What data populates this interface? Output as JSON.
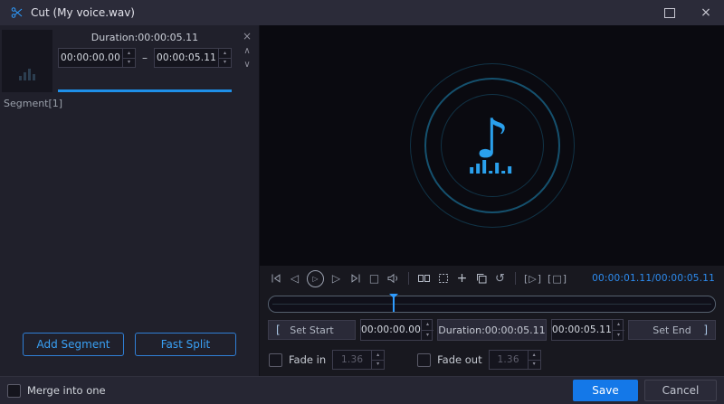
{
  "titlebar": {
    "title": "Cut (My voice.wav)"
  },
  "left_panel": {
    "duration_label": "Duration:00:00:05.11",
    "start_time": "00:00:00.00",
    "range_separator": "–",
    "end_time": "00:00:05.11",
    "segment_label": "Segment[1]",
    "add_segment_button": "Add Segment",
    "fast_split_button": "Fast Split"
  },
  "transport": {
    "time_display": "00:00:01.11/00:00:05.11"
  },
  "timeline": {
    "marker_style": "left:28%"
  },
  "trim": {
    "set_start_label": "Set Start",
    "start_time": "00:00:00.00",
    "duration_label": "Duration:00:00:05.11",
    "end_time": "00:00:05.11",
    "set_end_label": "Set End"
  },
  "fade": {
    "fade_in_label": "Fade in",
    "fade_in_value": "1.36",
    "fade_out_label": "Fade out",
    "fade_out_value": "1.36"
  },
  "footer": {
    "merge_label": "Merge into one",
    "save_button": "Save",
    "cancel_button": "Cancel"
  },
  "icons": {
    "spin_up": "▴",
    "spin_down": "▾",
    "window_close": "×",
    "segment_remove": "×",
    "segment_move_up": "∧",
    "segment_move_down": "∨",
    "step_back": "◁",
    "play": "▷",
    "step_forward": "▷",
    "stop": "□",
    "plus": "+",
    "reset": "↺",
    "play_segment": "[▷]",
    "stop_segment": "[□]",
    "bracket_left": "[",
    "bracket_right": "]",
    "music_note": "♪"
  },
  "colors": {
    "accent_blue": "#2e9cff",
    "time_blue": "#2d8cf0",
    "progress_blue": "#1e8fe8",
    "save_button_bg": "#1478e8"
  }
}
